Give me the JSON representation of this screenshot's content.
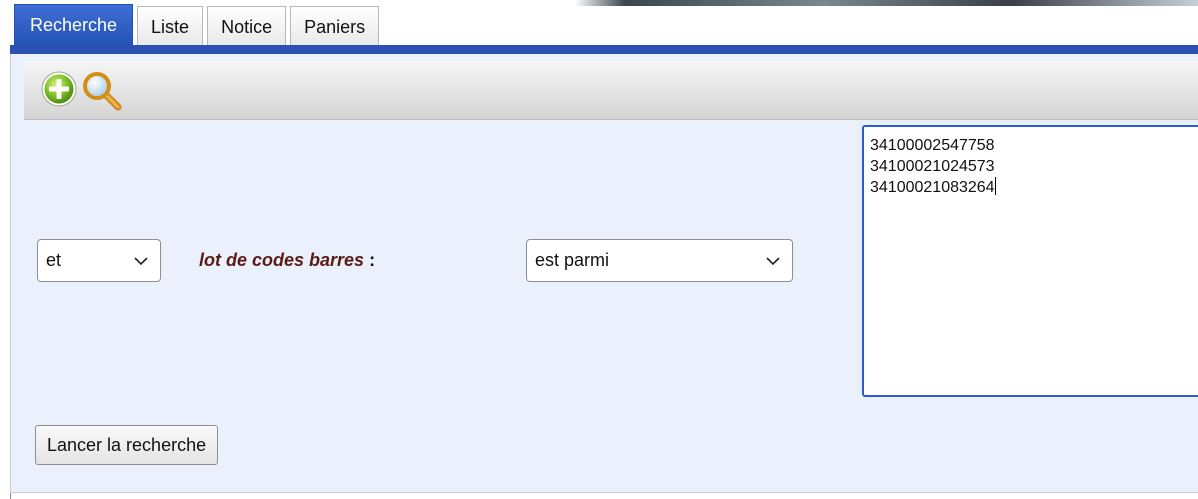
{
  "tabs": [
    {
      "label": "Recherche",
      "active": true
    },
    {
      "label": "Liste",
      "active": false
    },
    {
      "label": "Notice",
      "active": false
    },
    {
      "label": "Paniers",
      "active": false
    }
  ],
  "toolbar": {
    "icons": [
      "add-icon",
      "search-icon"
    ]
  },
  "criteria": {
    "operator": "et",
    "field_label": "lot de codes barres",
    "field_colon": " :",
    "comparator": "est parmi",
    "barcodes": [
      "34100002547758",
      "34100021024573",
      "34100021083264"
    ]
  },
  "launch_button": "Lancer la recherche",
  "colors": {
    "accent": "#2b52b3",
    "panel": "#ebf1fc",
    "label": "#5a1c14"
  }
}
